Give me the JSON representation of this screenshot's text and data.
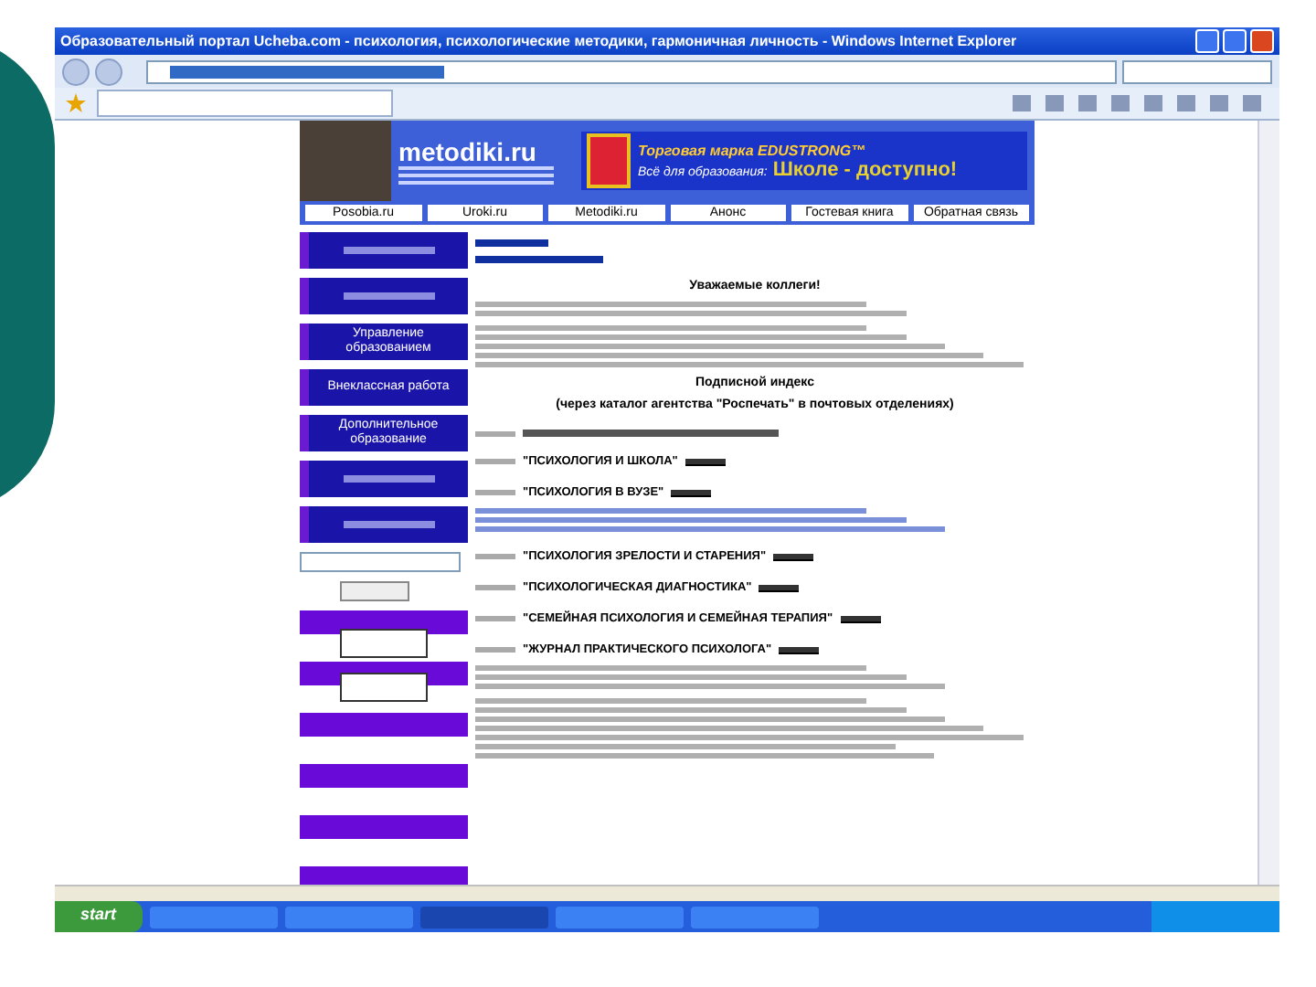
{
  "window": {
    "title": "Образовательный портал Ucheba.com - психология, психологические методики, гармоничная личность - Windows Internet Explorer"
  },
  "header": {
    "logo": "metodiki.ru",
    "brand_line": "Торговая марка EDUSTRONG™",
    "slogan_lead": "Всё для образования:",
    "slogan": "Школе - доступно!"
  },
  "nav": [
    {
      "label": "Posobia.ru"
    },
    {
      "label": "Uroki.ru"
    },
    {
      "label": "Metodiki.ru"
    },
    {
      "label": "Анонс"
    },
    {
      "label": "Гостевая книга"
    },
    {
      "label": "Обратная связь"
    }
  ],
  "side_menu": [
    {
      "kind": "blurred"
    },
    {
      "kind": "blurred"
    },
    {
      "kind": "text",
      "label": "Управление образованием"
    },
    {
      "kind": "text",
      "label": "Внеклассная работа"
    },
    {
      "kind": "text",
      "label": "Дополнительное образование"
    },
    {
      "kind": "blurred"
    },
    {
      "kind": "blurred"
    }
  ],
  "content": {
    "greeting": "Уважаемые коллеги!",
    "subscription_title": "Подписной индекс",
    "subscription_note": "(через каталог агентства \"Роспечать\" в почтовых отделениях)",
    "journals": [
      {
        "kind": "journal",
        "title": "\"ПСИХОЛОГИЯ И ШКОЛА\""
      },
      {
        "kind": "journal",
        "title": "\"ПСИХОЛОГИЯ В ВУЗЕ\""
      },
      {
        "kind": "description"
      },
      {
        "kind": "journal",
        "title": "\"ПСИХОЛОГИЯ ЗРЕЛОСТИ И СТАРЕНИЯ\""
      },
      {
        "kind": "journal",
        "title": "\"ПСИХОЛОГИЧЕСКАЯ ДИАГНОСТИКА\""
      },
      {
        "kind": "journal",
        "title": "\"СЕМЕЙНАЯ ПСИХОЛОГИЯ И СЕМЕЙНАЯ ТЕРАПИЯ\""
      },
      {
        "kind": "journal",
        "title": "\"ЖУРНАЛ ПРАКТИЧЕСКОГО ПСИХОЛОГА\""
      }
    ]
  },
  "taskbar": {
    "start": "start"
  }
}
